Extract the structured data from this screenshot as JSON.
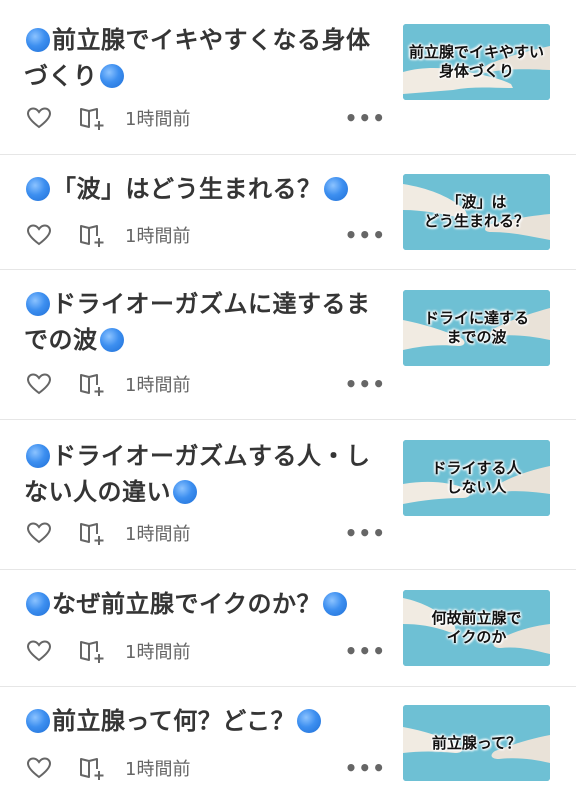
{
  "feed": {
    "items": [
      {
        "title_main": "前立腺でイキやすくなる身体づくり",
        "time": "1時間前",
        "more": "•••",
        "thumb_text": "前立腺でイキやすい\n身体づくり"
      },
      {
        "title_main": "「波」はどう生まれる？",
        "time": "1時間前",
        "more": "•••",
        "thumb_text": "「波」は\nどう生まれる？"
      },
      {
        "title_main": "ドライオーガズムに達するまでの波",
        "time": "1時間前",
        "more": "•••",
        "thumb_text": "ドライに達する\nまでの波"
      },
      {
        "title_main": "ドライオーガズムする人・しない人の違い",
        "time": "1時間前",
        "more": "•••",
        "thumb_text": "ドライする人\nしない人"
      },
      {
        "title_main": "なぜ前立腺でイクのか？",
        "time": "1時間前",
        "more": "•••",
        "thumb_text": "何故前立腺で\nイクのか"
      },
      {
        "title_main": "前立腺って何？どこ？",
        "time": "1時間前",
        "more": "•••",
        "thumb_text": "前立腺って？"
      }
    ],
    "icons": {
      "like": "heart-icon",
      "save": "book-plus-icon",
      "menu": "more-icon",
      "title_bullet": "blue-dot-icon"
    },
    "colors": {
      "bullet": "#3d8ff0",
      "thumb_bg": "#6ec0d4",
      "text": "#353535",
      "meta": "#666666"
    }
  }
}
